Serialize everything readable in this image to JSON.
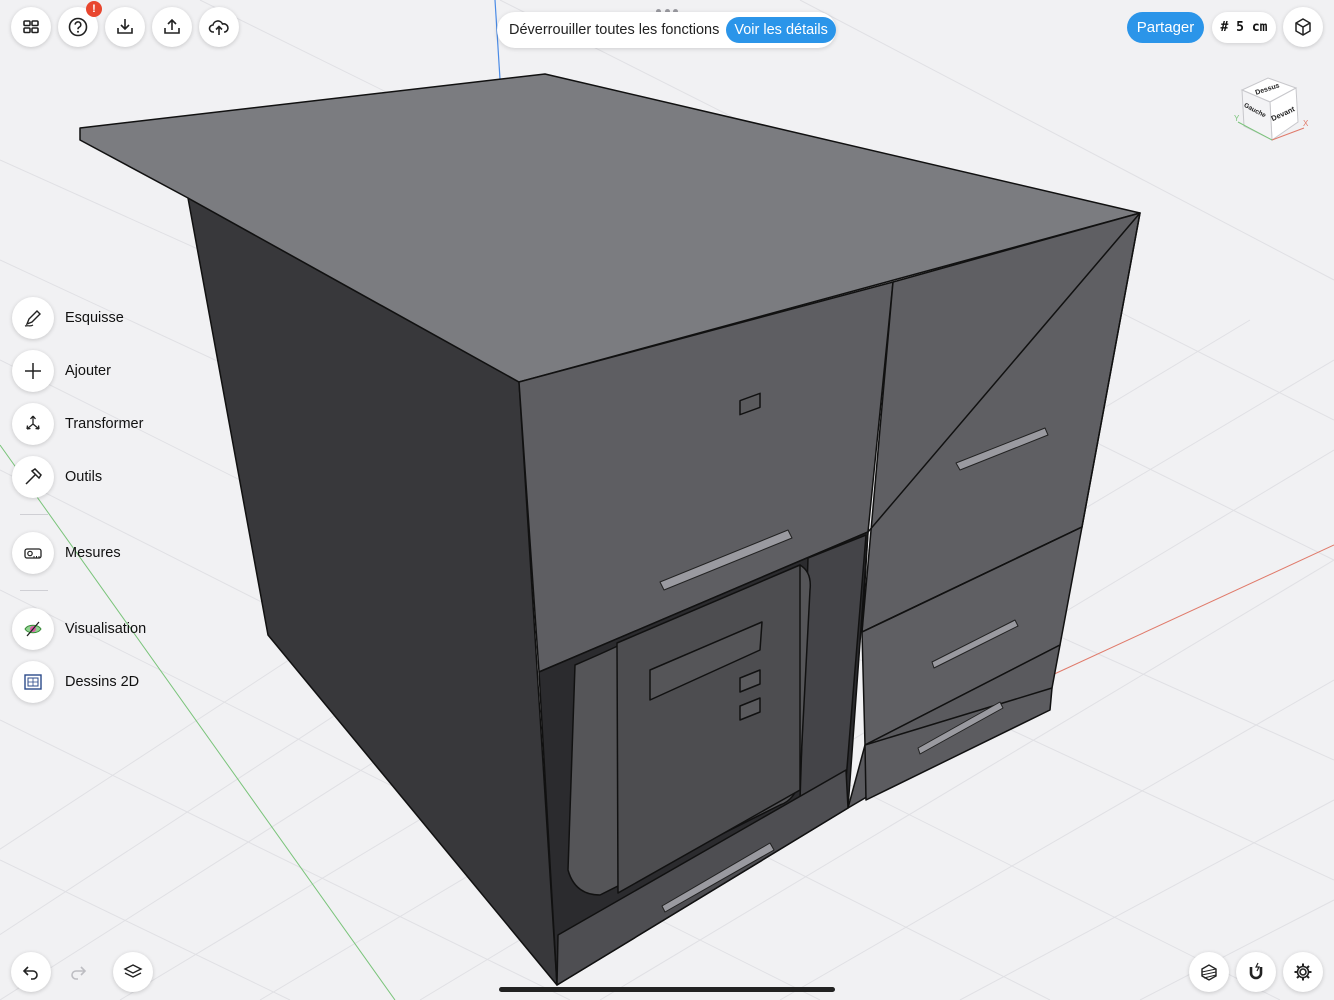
{
  "top_bar": {
    "notification_badge": "!",
    "banner_text": "Déverrouiller toutes les fonctions",
    "banner_link": "Voir les détails",
    "share_label": "Partager",
    "grid_size": "# 5 cm"
  },
  "sidebar": {
    "items": [
      {
        "label": "Esquisse",
        "icon": "pencil-icon"
      },
      {
        "label": "Ajouter",
        "icon": "plus-icon"
      },
      {
        "label": "Transformer",
        "icon": "transform-icon"
      },
      {
        "label": "Outils",
        "icon": "hammer-icon"
      },
      {
        "label": "Mesures",
        "icon": "tape-measure-icon"
      },
      {
        "label": "Visualisation",
        "icon": "visualization-icon"
      },
      {
        "label": "Dessins 2D",
        "icon": "drawing-2d-icon"
      }
    ]
  },
  "view_cube": {
    "top": "Dessus",
    "front": "Devant",
    "left": "Gauche",
    "axis_x": "X",
    "axis_y": "Y"
  },
  "colors": {
    "accent": "#2b95e9",
    "badge": "#e8462e",
    "model_top": "#7b7c80",
    "model_front": "#5e5e62",
    "model_side": "#38383b"
  }
}
